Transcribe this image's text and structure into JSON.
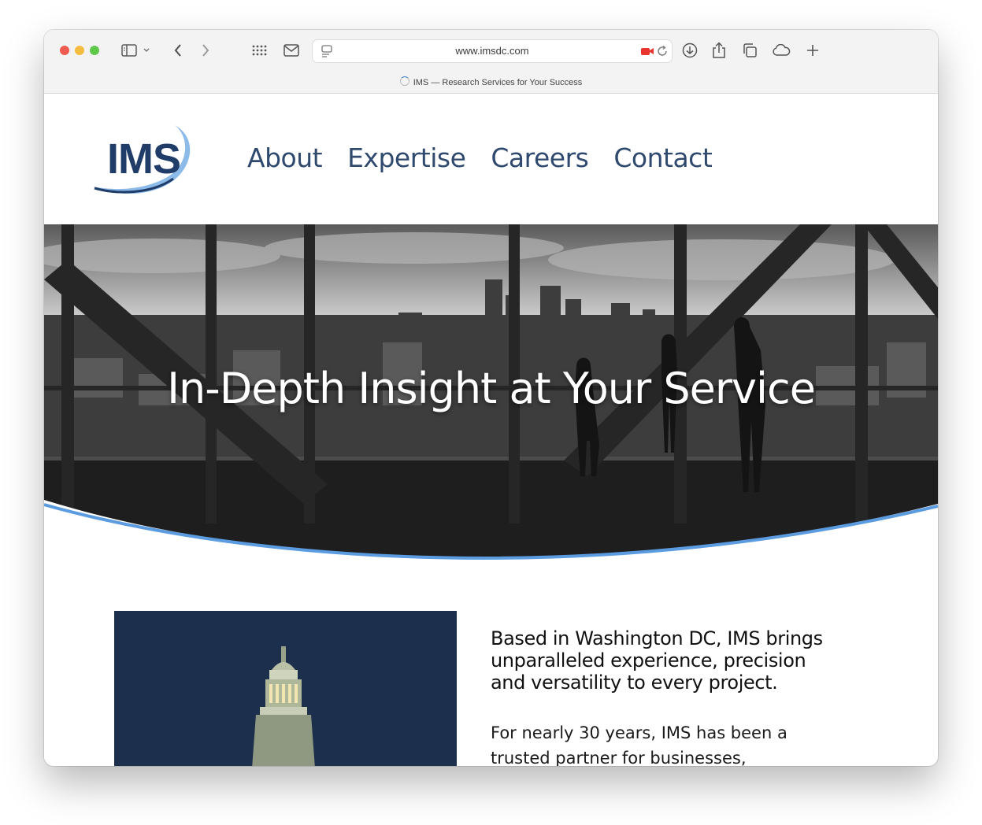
{
  "browser": {
    "url": "www.imsdc.com",
    "tab_title": "IMS — Research Services for Your Success"
  },
  "site": {
    "logo_text": "IMS",
    "nav": [
      "About",
      "Expertise",
      "Careers",
      "Contact"
    ],
    "hero_title": "In-Depth Insight at Your Service",
    "headline": "Based in Washington DC, IMS brings unparalleled experience, precision and versatility to every project.",
    "paragraph": "For nearly 30 years, IMS has been a trusted partner for businesses,"
  },
  "colors": {
    "brand_navy": "#1f3d68",
    "nav_text": "#2f4a6e",
    "accent_blue": "#5b9be0",
    "record_red": "#e8362f"
  },
  "icons": [
    "sidebar-icon",
    "chevron-down-icon",
    "back-icon",
    "forward-icon",
    "grid-icon",
    "mail-icon",
    "reader-icon",
    "camera-recording-icon",
    "reload-icon",
    "download-icon",
    "share-icon",
    "tabs-icon",
    "cloud-icon",
    "plus-icon"
  ]
}
